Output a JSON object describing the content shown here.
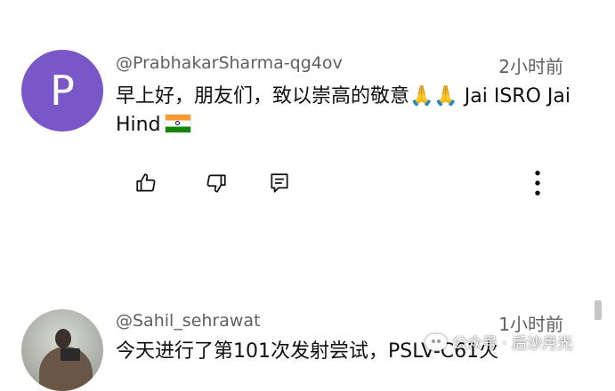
{
  "comments": [
    {
      "avatar_letter": "P",
      "avatar_color": "#7a57c9",
      "author": "@PrabhakarSharma-qg4ov",
      "time": "2小时前",
      "text": "早上好，朋友们，致以崇高的敬意🙏🙏 Jai ISRO Jai Hind",
      "flag_icon": "india-flag-icon"
    },
    {
      "author": "@Sahil_sehrawat",
      "time": "1小时前",
      "text": "今天进行了第101次发射尝试，PSLV-C61火"
    }
  ],
  "actions": {
    "like_icon": "thumbs-up-icon",
    "dislike_icon": "thumbs-down-icon",
    "reply_icon": "reply-icon",
    "more_icon": "more-vertical-icon"
  },
  "watermark": {
    "text": "公众号 · 后沙月光"
  }
}
